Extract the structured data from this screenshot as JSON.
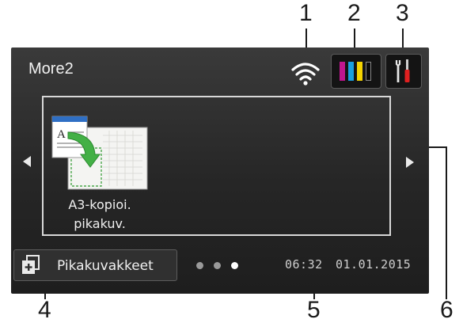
{
  "callouts": [
    "1",
    "2",
    "3",
    "4",
    "5",
    "6"
  ],
  "header": {
    "title": "More2"
  },
  "icons": {
    "wifi": "wifi-icon",
    "ink": "ink-cartridges-icon",
    "settings": "tools-icon",
    "shortcuts": "add-shortcut-icon"
  },
  "ink_colors": [
    "#c0168e",
    "#1aa0e0",
    "#f5d400",
    "#111111"
  ],
  "shortcut": {
    "label_line1": "A3-kopioi.",
    "label_line2": "pikakuv."
  },
  "footer": {
    "shortcuts_label": "Pikakuvakkeet",
    "page_dots": 3,
    "active_page": 3,
    "time": "06:32",
    "date": "01.01.2015"
  }
}
